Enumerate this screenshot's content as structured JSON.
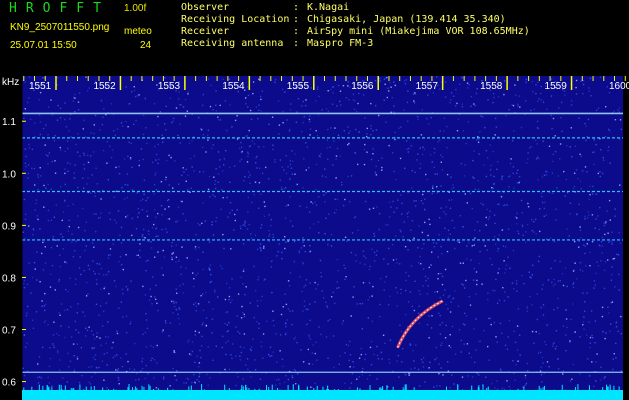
{
  "header": {
    "brand": "HROFFT",
    "version": "1.00f",
    "filename": "KN9_2507011550.png",
    "mode_label": "meteo",
    "timestamp": "25.07.01 15:50",
    "count": "24"
  },
  "info": [
    {
      "label": "Observer",
      "value": "K.Nagai"
    },
    {
      "label": "Receiving Location",
      "value": "Chigasaki, Japan (139.414 35.340)"
    },
    {
      "label": "Receiver",
      "value": "AirSpy mini (Miakejima VOR 108.65MHz)"
    },
    {
      "label": "Receiving antenna",
      "value": "Maspro FM-3"
    }
  ],
  "chart_data": {
    "type": "heatmap",
    "ylabel": "kHz",
    "x_ticks": [
      "1551",
      "1552",
      "1553",
      "1554",
      "1555",
      "1556",
      "1557",
      "1558",
      "1559",
      "1600"
    ],
    "y_ticks": [
      "1.1",
      "1.0",
      "0.9",
      "0.8",
      "0.7",
      "0.6"
    ],
    "ylim": [
      0.58,
      1.16
    ],
    "horizontal_lines_khz": [
      1.115,
      1.068,
      0.965,
      0.872,
      0.618
    ],
    "meteor_echo": {
      "start_time": "1556.3",
      "end_time": "1557.0",
      "start_khz": 0.665,
      "end_khz": 0.755
    },
    "colors": {
      "background": "#0b0b8c",
      "noise": "#3a5bff",
      "line": "#33d6ff",
      "tick": "#ffff00",
      "axis_bottom": "#00e5ff"
    }
  }
}
